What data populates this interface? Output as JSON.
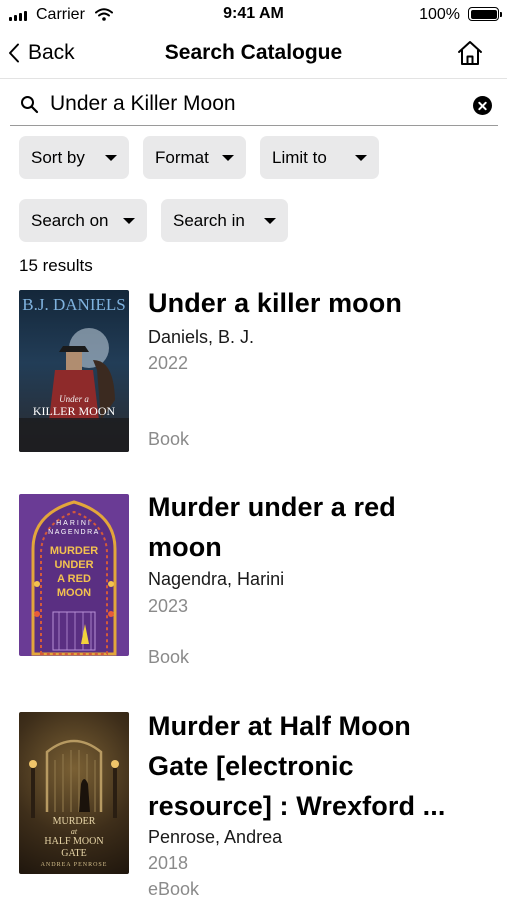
{
  "status_bar": {
    "carrier": "Carrier",
    "time": "9:41 AM",
    "battery": "100%",
    "icons": [
      "signal-icon",
      "wifi-icon",
      "battery-icon"
    ]
  },
  "nav": {
    "back_label": "Back",
    "title": "Search Catalogue",
    "icons": [
      "chevron-left-icon",
      "home-icon"
    ]
  },
  "search": {
    "value": "Under a Killer Moon",
    "icons": [
      "search-icon",
      "clear-icon"
    ]
  },
  "filters": {
    "sort_by": "Sort by",
    "format": "Format",
    "limit_to": "Limit to",
    "search_on": "Search on",
    "search_in": "Search in"
  },
  "results_count": "15 results",
  "results": [
    {
      "title": "Under a killer moon",
      "author": "Daniels, B. J.",
      "year": "2022",
      "format": "Book",
      "cover": {
        "author": "B.J. DANIELS",
        "title_top": "Under a",
        "title_bottom": "KILLER MOON",
        "colors": {
          "background": "#1d3144",
          "accent": "#7fb2de"
        }
      }
    },
    {
      "title": "Murder under a red moon",
      "author": "Nagendra, Harini",
      "year": "2023",
      "format": "Book",
      "cover": {
        "author_top": "HARINI",
        "author_bottom": "NAGENDRA",
        "title_lines": [
          "MURDER",
          "UNDER",
          "A RED",
          "MOON"
        ],
        "colors": {
          "background": "#6a3b95",
          "accent": "#f3c24f"
        }
      }
    },
    {
      "title": "Murder at Half Moon Gate [electronic resource] : Wrexford ...",
      "author": "Penrose, Andrea",
      "year": "2018",
      "format": "eBook",
      "cover": {
        "title_lines": [
          "MURDER",
          "at",
          "HALF MOON",
          "GATE"
        ],
        "author": "ANDREA PENROSE",
        "colors": {
          "background": "#3a2b1b",
          "accent": "#e8d6a8"
        }
      }
    }
  ]
}
